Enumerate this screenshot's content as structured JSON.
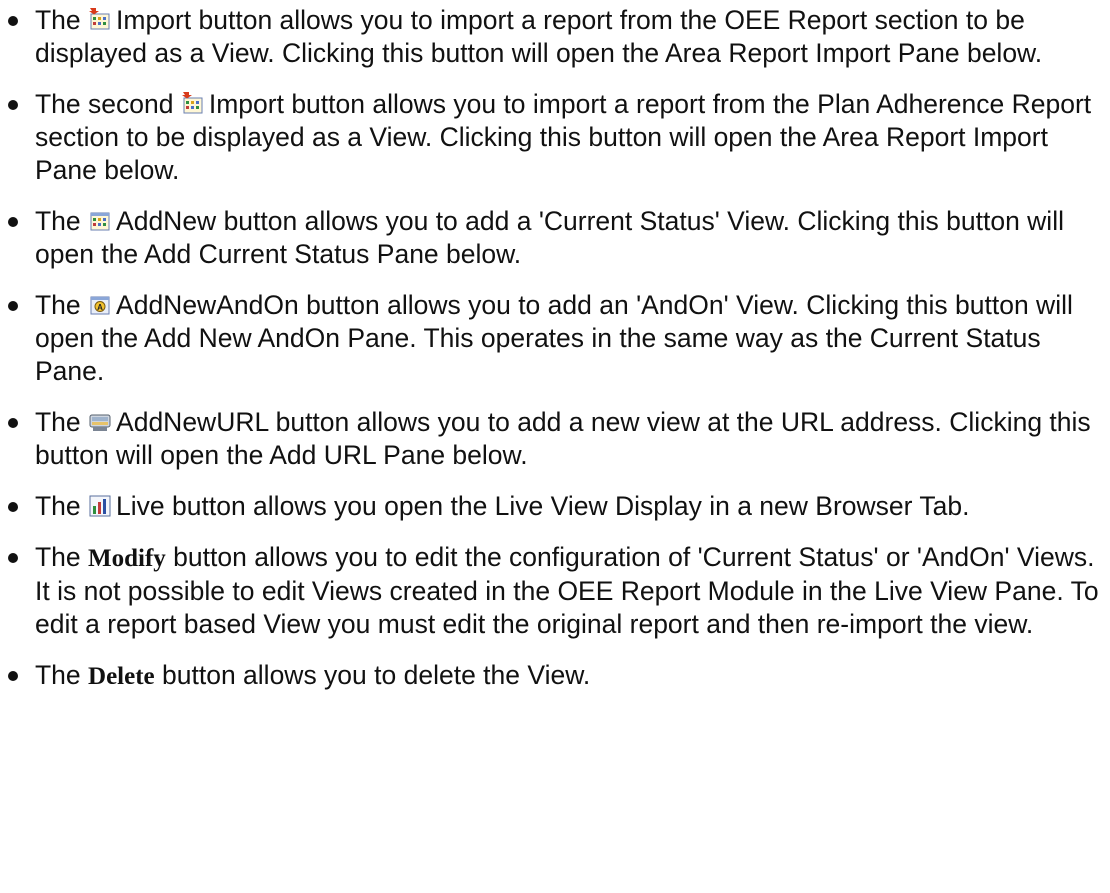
{
  "items": [
    {
      "pre": "The ",
      "icon": "import-icon",
      "button": "Import",
      "text": " button allows you to import a report from the OEE Report section to be displayed as a View. Clicking this button will open the Area Report Import Pane below."
    },
    {
      "pre": "The second ",
      "icon": "import-icon",
      "button": "Import",
      "text": " button allows you to import a report from the Plan Adherence Report section to be displayed as a View. Clicking this button will open the Area Report Import Pane below."
    },
    {
      "pre": "The ",
      "icon": "add-new-icon",
      "button": "AddNew",
      "text": " button allows you to add a 'Current Status' View. Clicking this button will open the Add Current Status Pane below."
    },
    {
      "pre": "The ",
      "icon": "add-new-andon-icon",
      "button": "AddNewAndOn",
      "text": " button allows you to add an 'AndOn' View. Clicking this button will open the Add New AndOn Pane. This operates in the same way as the Current Status Pane."
    },
    {
      "pre": "The ",
      "icon": "add-new-url-icon",
      "button": "AddNewURL",
      "text": " button allows you to add a new view at the URL address. Clicking this button will open the Add URL Pane below."
    },
    {
      "pre": "The ",
      "icon": "live-chart-icon",
      "button": "Live",
      "text": " button allows you open the Live View Display in a new Browser Tab."
    },
    {
      "pre": "The ",
      "button": "Modify",
      "text": " button allows you to edit the configuration of 'Current Status' or 'AndOn' Views. It is not possible to edit Views created in the OEE Report Module in the Live View Pane. To edit a report based View you must edit the original report and then re-import the view."
    },
    {
      "pre": "The ",
      "button": "Delete",
      "text": " button allows you to delete the View."
    }
  ]
}
